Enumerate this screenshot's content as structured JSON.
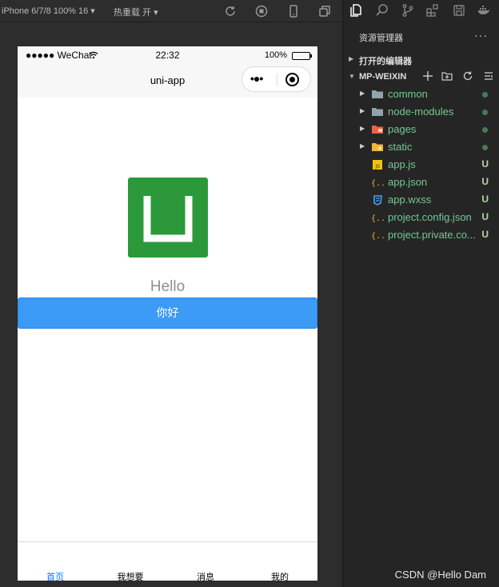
{
  "simulator": {
    "device_label": "iPhone 6/7/8 100% 16 ▾",
    "hot_reload_label": "热重载 开 ▾"
  },
  "phone": {
    "status": {
      "carrier": "●●●●● WeChat",
      "time": "22:32",
      "battery": "100%"
    },
    "nav_title": "uni-app",
    "capsule_dots": "•●•",
    "hello_text": "Hello",
    "button_label": "你好",
    "tabs": [
      {
        "label": "首页",
        "active": true
      },
      {
        "label": "我想要",
        "active": false
      },
      {
        "label": "消息",
        "active": false
      },
      {
        "label": "我的",
        "active": false
      }
    ]
  },
  "explorer": {
    "title": "资源管理器",
    "more": "···",
    "open_editors": "打开的编辑器",
    "project": "MP-WEIXIN",
    "folders": [
      {
        "name": "common",
        "status": "dot"
      },
      {
        "name": "node-modules",
        "status": "dot"
      },
      {
        "name": "pages",
        "status": "dot"
      },
      {
        "name": "static",
        "status": "dot"
      }
    ],
    "files": [
      {
        "name": "app.js",
        "status": "U"
      },
      {
        "name": "app.json",
        "status": "U"
      },
      {
        "name": "app.wxss",
        "status": "U"
      },
      {
        "name": "project.config.json",
        "status": "U"
      },
      {
        "name": "project.private.co...",
        "status": "U"
      }
    ]
  },
  "watermark": "CSDN @Hello Dam",
  "colors": {
    "accent": "#007aff",
    "button": "#3b9bf6",
    "logo": "#2b9939",
    "git_added": "#73c991"
  }
}
